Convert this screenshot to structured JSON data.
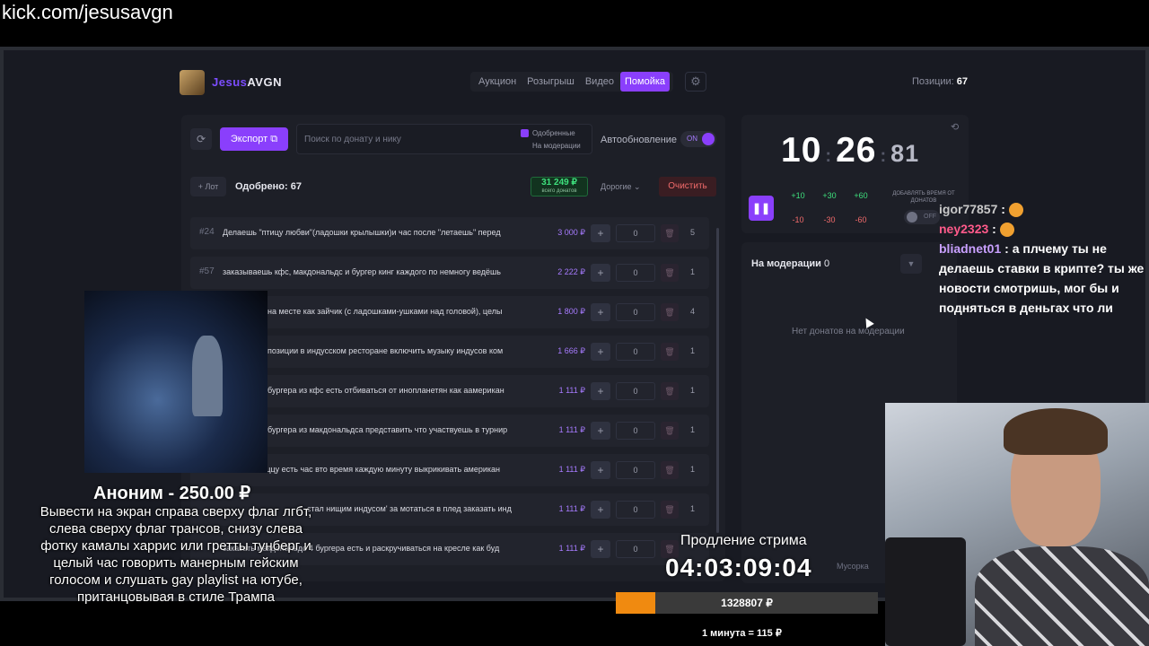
{
  "browser": {
    "url": "kick.com/jesusavgn"
  },
  "brand": {
    "part1": "Jesus",
    "part2": "AVGN"
  },
  "nav": {
    "tabs": [
      "Аукцион",
      "Розыгрыш",
      "Видео",
      "Помойка"
    ],
    "active_index": 3
  },
  "positions": {
    "label": "Позиции:",
    "value": "67"
  },
  "toolbar": {
    "export_label": "Экспорт",
    "search_placeholder": "Поиск по донату и нику",
    "filter_approved": "Одобренные",
    "filter_moderation": "На модерации",
    "autoupdate_label": "Автообновление",
    "autoupdate_state": "ON"
  },
  "list_header": {
    "lot_button": "+ Лот",
    "approved_label": "Одобрено: 67",
    "total_amount": "31 249 ₽",
    "total_caption": "всего донатов",
    "sort_label": "Дорогие",
    "clear_label": "Очистить"
  },
  "lots": [
    {
      "num": "#24",
      "text": "Делаешь \"птицу любви\"(ладошки крылышки)и час после \"летаешь\" перед",
      "amount": "3 000 ₽",
      "qty": "0",
      "count": "5"
    },
    {
      "num": "#57",
      "text": "заказываешь кфс, макдональдс и бургер кинг каждого по немногу ведёшь",
      "amount": "2 222 ₽",
      "qty": "0",
      "count": "1"
    },
    {
      "num": "",
      "text": "на месте как зайчик (с ладошками-ушками над головой), целы",
      "amount": "1 800 ₽",
      "qty": "0",
      "count": "4"
    },
    {
      "num": "",
      "text": "позиции в индусском ресторане включить музыку индусов ком",
      "amount": "1 666 ₽",
      "qty": "0",
      "count": "1"
    },
    {
      "num": "",
      "text": "бургера из кфс есть отбиваться от инопланетян как аамерикан",
      "amount": "1 111 ₽",
      "qty": "0",
      "count": "1"
    },
    {
      "num": "",
      "text": "бургера из макдональдса представить что участвуешь в турнир",
      "amount": "1 111 ₽",
      "qty": "0",
      "count": "1"
    },
    {
      "num": "",
      "text": "заказать пиццу есть час вто время каждую минуту выкрикивать американ",
      "amount": "1 111 ₽",
      "qty": "0",
      "count": "1"
    },
    {
      "num": "",
      "text": "стал нищим индусом' за мотаться в плед заказать инд",
      "amount": "1 111 ₽",
      "qty": "0",
      "count": "1"
    },
    {
      "num": "",
      "text": "заказать макдональдс 4 бургера есть и раскручиваться на кресле как буд",
      "amount": "1 111 ₽",
      "qty": "0",
      "count": "1"
    }
  ],
  "timer": {
    "minutes": "10",
    "seconds": "26",
    "centis": "81",
    "plus": [
      "+10",
      "+30",
      "+60"
    ],
    "minus": [
      "-10",
      "-30",
      "-60"
    ],
    "add_time_label": "ДОБАВЛЯТЬ ВРЕМЯ ОТ ДОНАТОВ",
    "add_time_state": "OFF"
  },
  "moderation": {
    "title": "На модерации",
    "count": "0",
    "empty_text": "Нет донатов на модерации"
  },
  "trash_label": "Мусорка",
  "chat": [
    {
      "user": "igor77857",
      "text": ":"
    },
    {
      "user": "ney2323",
      "text": ":"
    },
    {
      "user": "bliadnet01",
      "text": ": а плчему ты не делаешь ставки в крипте? ты же новости смотришь, мог бы и подняться в деньгах что ли"
    }
  ],
  "donation": {
    "donor": "Аноним - 250.00 ₽",
    "message": "Вывести на экран справа сверху флаг лгбт, слева сверху флаг трансов, снизу слева фотку камалы харрис или гретты тунберг и целый час говорить манерным гейским голосом и слушать gay playlist на ютубе, пританцовывая в стиле Трампа"
  },
  "stream_extension": {
    "label": "Продление стрима",
    "timer": "04:03:09:04",
    "amount": "1328807 ₽",
    "progress_fraction": 0.15,
    "rate": "1 минута = 115 ₽"
  },
  "colors": {
    "accent": "#8a3ffc",
    "green": "#3ee07d",
    "red": "#f26b6b",
    "progress": "#f08a10"
  }
}
